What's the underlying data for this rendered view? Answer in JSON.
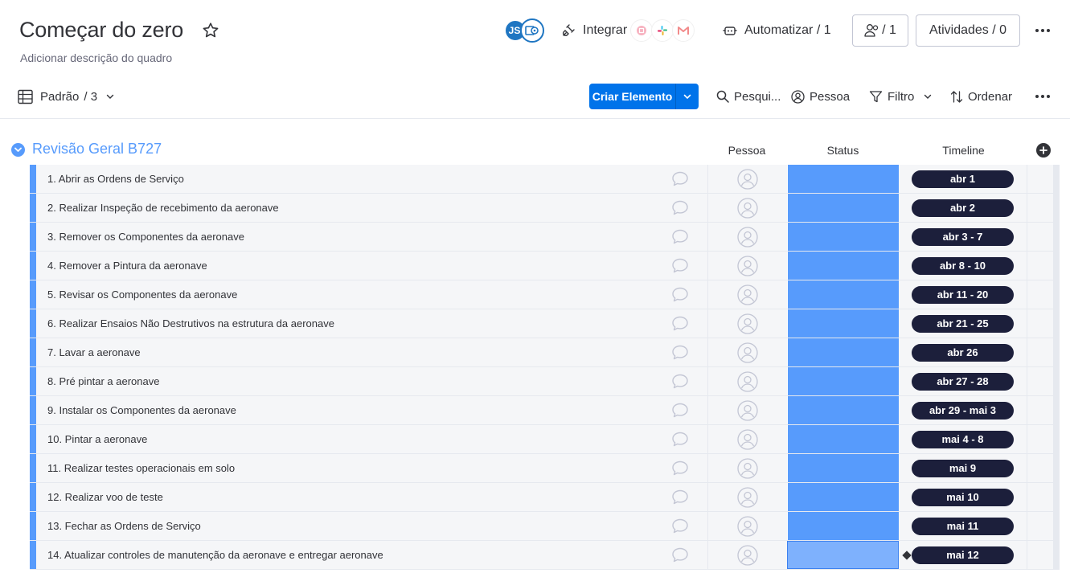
{
  "board": {
    "title": "Começar do zero",
    "description": "Adicionar descrição do quadro"
  },
  "header": {
    "avatar_initials": "JS",
    "integrate_label": "Integrar",
    "automate_label": "Automatizar / 1",
    "members_label": "/ 1",
    "activities_label": "Atividades / 0"
  },
  "toolbar": {
    "view_label": "Padrão",
    "view_count": "/ 3",
    "new_item_label": "Criar Elemento",
    "search_label": "Pesqui...",
    "person_label": "Pessoa",
    "filter_label": "Filtro",
    "sort_label": "Ordenar"
  },
  "group": {
    "title": "Revisão Geral B727",
    "color": "#579bfc",
    "columns": {
      "person": "Pessoa",
      "status": "Status",
      "timeline": "Timeline"
    },
    "rows": [
      {
        "name": "1. Abrir as Ordens de Serviço",
        "timeline": "abr 1"
      },
      {
        "name": "2. Realizar Inspeção de recebimento da aeronave",
        "timeline": "abr 2"
      },
      {
        "name": "3. Remover os Componentes da aeronave",
        "timeline": "abr 3 - 7"
      },
      {
        "name": "4. Remover a Pintura da aeronave",
        "timeline": "abr 8 - 10"
      },
      {
        "name": "5. Revisar os Componentes da aeronave",
        "timeline": "abr 11 - 20"
      },
      {
        "name": "6. Realizar Ensaios Não Destrutivos na estrutura da aeronave",
        "timeline": "abr 21 - 25"
      },
      {
        "name": "7. Lavar a aeronave",
        "timeline": "abr 26"
      },
      {
        "name": "8. Pré pintar a aeronave",
        "timeline": "abr 27 - 28"
      },
      {
        "name": "9. Instalar os Componentes da aeronave",
        "timeline": "abr 29 - mai 3"
      },
      {
        "name": "10. Pintar a aeronave",
        "timeline": "mai 4 - 8"
      },
      {
        "name": "11. Realizar testes operacionais em solo",
        "timeline": "mai 9"
      },
      {
        "name": "12. Realizar voo de teste",
        "timeline": "mai 10"
      },
      {
        "name": "13. Fechar as Ordens de Serviço",
        "timeline": "mai 11"
      },
      {
        "name": "14. Atualizar controles de manutenção da aeronave e entregar aeronave",
        "timeline": "mai 12"
      }
    ]
  },
  "colors": {
    "primary": "#0073ea",
    "group_blue": "#579bfc",
    "timeline_pill": "#1c1f3b"
  }
}
